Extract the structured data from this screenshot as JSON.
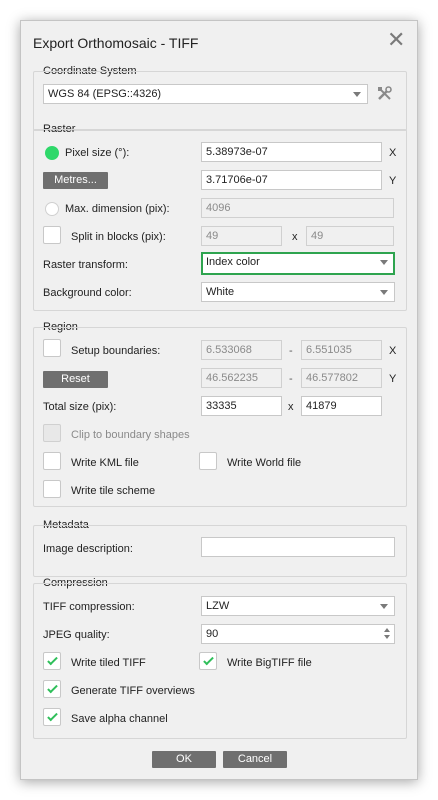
{
  "dialog": {
    "title": "Export Orthomosaic - TIFF",
    "close_glyph": "✕"
  },
  "coordinate_system": {
    "section_title": "Coordinate System",
    "value": "WGS 84 (EPSG::4326)",
    "settings_icon": "tools-icon"
  },
  "raster": {
    "section_title": "Raster",
    "pixel_size_label": "Pixel size (°):",
    "pixel_size_x": "5.38973e-07",
    "pixel_size_y": "3.71706e-07",
    "x_axis": "X",
    "y_axis": "Y",
    "metres_button": "Metres...",
    "max_dimension_label": "Max. dimension (pix):",
    "max_dimension_value": "4096",
    "split_label": "Split in blocks (pix):",
    "split_w": "49",
    "split_x": "x",
    "split_h": "49",
    "transform_label": "Raster transform:",
    "transform_value": "Index color",
    "background_label": "Background color:",
    "background_value": "White"
  },
  "region": {
    "section_title": "Region",
    "setup_label": "Setup boundaries:",
    "x_min": "6.533068",
    "x_max": "6.551035",
    "y_min": "46.562235",
    "y_max": "46.577802",
    "dash": "-",
    "x_axis": "X",
    "y_axis": "Y",
    "reset_button": "Reset",
    "total_size_label": "Total size (pix):",
    "total_w": "33335",
    "total_x": "x",
    "total_h": "41879",
    "clip_label": "Clip to boundary shapes",
    "kml_label": "Write KML file",
    "world_label": "Write World file",
    "tile_label": "Write tile scheme"
  },
  "metadata": {
    "section_title": "Metadata",
    "description_label": "Image description:",
    "description_value": ""
  },
  "compression": {
    "section_title": "Compression",
    "tiff_label": "TIFF compression:",
    "tiff_value": "LZW",
    "jpeg_label": "JPEG quality:",
    "jpeg_value": "90",
    "tiled_label": "Write tiled TIFF",
    "bigtiff_label": "Write BigTIFF file",
    "overviews_label": "Generate TIFF overviews",
    "alpha_label": "Save alpha channel"
  },
  "footer": {
    "ok_button": "OK",
    "cancel_button": "Cancel"
  },
  "colors": {
    "accent_green": "#2fbf5a",
    "highlight_border": "#2ea44f",
    "button_gray": "#6f6f6f"
  }
}
